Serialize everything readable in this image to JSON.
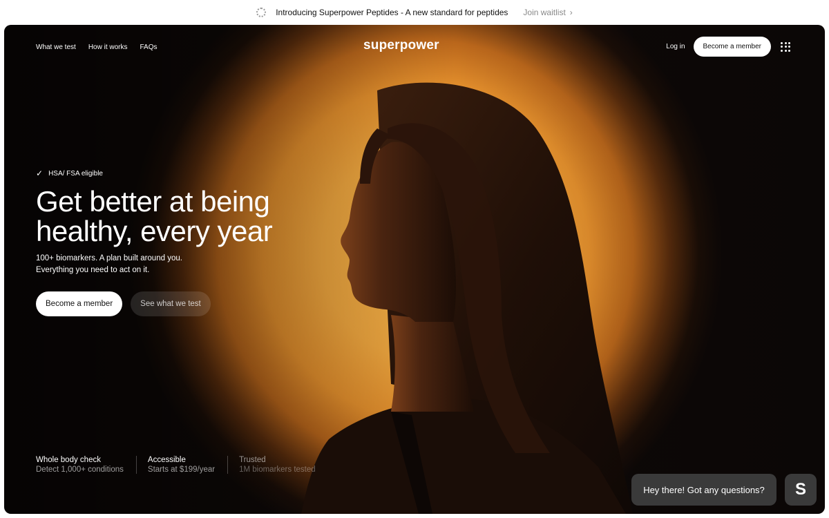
{
  "announcement": {
    "message": "Introducing Superpower Peptides - A new standard for peptides",
    "link": "Join waitlist"
  },
  "nav": {
    "links": [
      "What we test",
      "How it works",
      "FAQs"
    ],
    "logo": "superpower",
    "login": "Log in",
    "cta": "Become a member"
  },
  "hero": {
    "badge": "HSA/ FSA eligible",
    "headline_line1": "Get better at being",
    "headline_line2": "healthy, every year",
    "sub_line1": "100+ biomarkers. A plan built around you.",
    "sub_line2": "Everything you need to act on it.",
    "primary_cta": "Become a member",
    "secondary_cta": "See what we test"
  },
  "stats": [
    {
      "title": "Whole body check",
      "sub": "Detect 1,000+ conditions"
    },
    {
      "title": "Accessible",
      "sub": "Starts at $199/year"
    },
    {
      "title": "Trusted",
      "sub": "1M biomarkers tested"
    }
  ],
  "chat": {
    "bubble": "Hey there! Got any questions?",
    "button_letter": "S"
  },
  "colors": {
    "glow": "#f0a73f",
    "background_dark": "#0d0807",
    "chat_bg": "#3a3a3a"
  }
}
